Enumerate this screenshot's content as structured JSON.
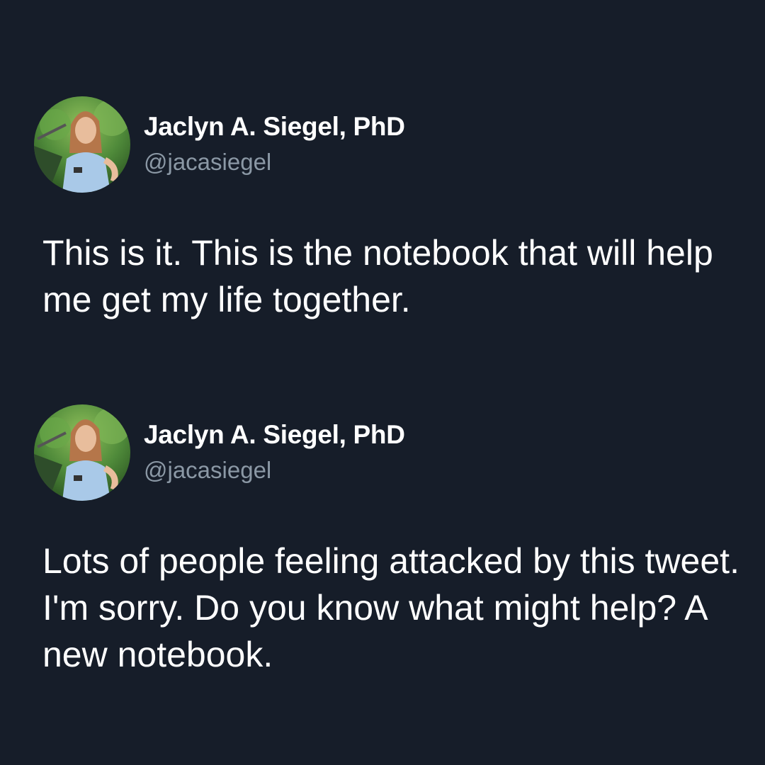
{
  "tweets": [
    {
      "author": {
        "display_name": "Jaclyn A. Siegel, PhD",
        "handle": "@jacasiegel",
        "avatar_icon": "profile-photo-avatar"
      },
      "text": "This is it. This is the notebook that will help me get my life together."
    },
    {
      "author": {
        "display_name": "Jaclyn A. Siegel, PhD",
        "handle": "@jacasiegel",
        "avatar_icon": "profile-photo-avatar"
      },
      "text": "Lots of people feeling attacked by this tweet. I'm sorry. Do you know what might help? A new notebook."
    }
  ],
  "colors": {
    "background": "#161d29",
    "primary_text": "#ffffff",
    "secondary_text": "#8b98a5"
  }
}
